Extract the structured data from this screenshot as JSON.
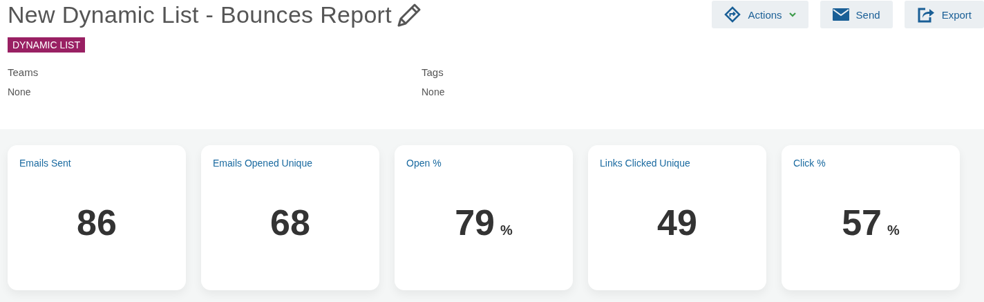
{
  "title": "New Dynamic List - Bounces Report",
  "badge": "DYNAMIC LIST",
  "buttons": [
    {
      "kind": "actions",
      "label": "Actions"
    },
    {
      "kind": "send",
      "label": "Send"
    },
    {
      "kind": "export",
      "label": "Export"
    }
  ],
  "fields": [
    {
      "label": "Teams",
      "value": "None"
    },
    {
      "label": "Tags",
      "value": "None"
    }
  ],
  "metrics": [
    {
      "label": "Emails Sent",
      "value": "86"
    },
    {
      "label": "Emails Opened Unique",
      "value": "68"
    },
    {
      "label": "Open %",
      "value": "79",
      "unit": "%"
    },
    {
      "label": "Links Clicked Unique",
      "value": "49"
    },
    {
      "label": "Click %",
      "value": "57",
      "unit": "%"
    }
  ]
}
